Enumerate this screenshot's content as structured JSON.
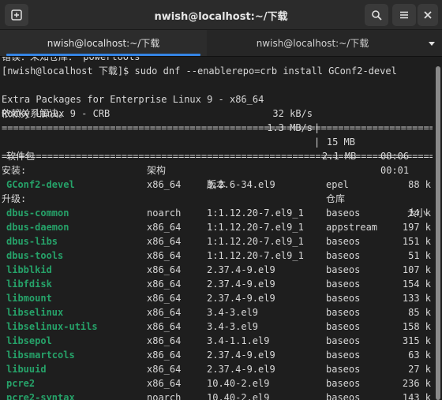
{
  "window": {
    "title": "nwish@localhost:~/下载",
    "new_tab_icon": "new-tab-icon",
    "search_icon": "search-icon",
    "menu_icon": "hamburger-menu-icon",
    "close_icon": "close-icon"
  },
  "tabs": [
    {
      "label": "nwish@localhost:~/下载",
      "active": true
    },
    {
      "label": "nwish@localhost:~/下载",
      "active": false
    }
  ],
  "terminal": {
    "cut_line": "错误：未知仓库：'powertools'",
    "prompt": "[nwish@localhost 下载]$ sudo dnf --enablerepo=crb install GConf2-devel",
    "repo1": {
      "name": "Extra Packages for Enterprise Linux 9 - x86_64",
      "speed": "32 kB/s",
      "size": "15 MB",
      "time": "08:06"
    },
    "repo2": {
      "name": "Rocky Linux 9 - CRB",
      "speed": "1.3 MB/s",
      "size": "2.1 MB",
      "time": "00:01"
    },
    "deps_resolved": "依赖关系解决。",
    "separator": "================================================================================",
    "headers": {
      "package": "软件包",
      "arch": "架构",
      "version": "版本",
      "repo": "仓库",
      "size": "大小"
    },
    "installing_label": "安装:",
    "upgrading_label": "升级:",
    "installing": [
      {
        "package": "GConf2-devel",
        "arch": "x86_64",
        "version": "3.2.6-34.el9",
        "repo": "epel",
        "size": "88 k"
      }
    ],
    "upgrading": [
      {
        "package": "dbus-common",
        "arch": "noarch",
        "version": "1:1.12.20-7.el9_1",
        "repo": "baseos",
        "size": "14 k"
      },
      {
        "package": "dbus-daemon",
        "arch": "x86_64",
        "version": "1:1.12.20-7.el9_1",
        "repo": "appstream",
        "size": "197 k"
      },
      {
        "package": "dbus-libs",
        "arch": "x86_64",
        "version": "1:1.12.20-7.el9_1",
        "repo": "baseos",
        "size": "151 k"
      },
      {
        "package": "dbus-tools",
        "arch": "x86_64",
        "version": "1:1.12.20-7.el9_1",
        "repo": "baseos",
        "size": "51 k"
      },
      {
        "package": "libblkid",
        "arch": "x86_64",
        "version": "2.37.4-9.el9",
        "repo": "baseos",
        "size": "107 k"
      },
      {
        "package": "libfdisk",
        "arch": "x86_64",
        "version": "2.37.4-9.el9",
        "repo": "baseos",
        "size": "154 k"
      },
      {
        "package": "libmount",
        "arch": "x86_64",
        "version": "2.37.4-9.el9",
        "repo": "baseos",
        "size": "133 k"
      },
      {
        "package": "libselinux",
        "arch": "x86_64",
        "version": "3.4-3.el9",
        "repo": "baseos",
        "size": "85 k"
      },
      {
        "package": "libselinux-utils",
        "arch": "x86_64",
        "version": "3.4-3.el9",
        "repo": "baseos",
        "size": "158 k"
      },
      {
        "package": "libsepol",
        "arch": "x86_64",
        "version": "3.4-1.1.el9",
        "repo": "baseos",
        "size": "315 k"
      },
      {
        "package": "libsmartcols",
        "arch": "x86_64",
        "version": "2.37.4-9.el9",
        "repo": "baseos",
        "size": "63 k"
      },
      {
        "package": "libuuid",
        "arch": "x86_64",
        "version": "2.37.4-9.el9",
        "repo": "baseos",
        "size": "27 k"
      },
      {
        "package": "pcre2",
        "arch": "x86_64",
        "version": "10.40-2.el9",
        "repo": "baseos",
        "size": "236 k"
      },
      {
        "package": "pcre2-syntax",
        "arch": "noarch",
        "version": "10.40-2.el9",
        "repo": "baseos",
        "size": "143 k"
      }
    ]
  },
  "colors": {
    "package_name": "#26a269",
    "background": "#1e1e1e",
    "text": "#d8d8d8",
    "accent": "#3584e4"
  }
}
